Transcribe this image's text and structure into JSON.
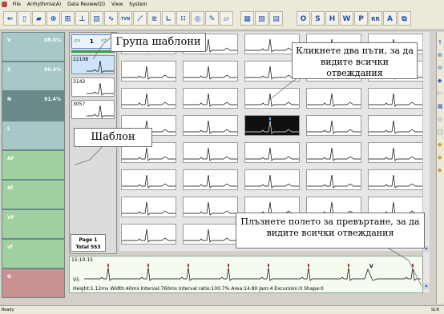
{
  "menu": {
    "items": [
      "File",
      "Arrhythmia(A)",
      "Data Review(D)",
      "View",
      "System"
    ]
  },
  "toolbar": {
    "letters": [
      "O",
      "S",
      "H",
      "W",
      "P",
      "RR",
      "A"
    ],
    "tvn_label": "TVN"
  },
  "categories": [
    {
      "name": "V",
      "pct": "08.0%"
    },
    {
      "name": "S",
      "pct": "00.4%"
    },
    {
      "name": "N",
      "pct": "91.4%"
    },
    {
      "name": "L",
      "pct": ""
    },
    {
      "name": "AF",
      "pct": ""
    },
    {
      "name": "Af",
      "pct": ""
    },
    {
      "name": "VF",
      "pct": ""
    },
    {
      "name": "vf",
      "pct": ""
    },
    {
      "name": "O",
      "pct": ""
    }
  ],
  "templates": {
    "page_indicator": "1",
    "items": [
      {
        "count": "22108"
      },
      {
        "count": "3142"
      },
      {
        "count": "3057"
      }
    ]
  },
  "pagination": {
    "page": "Page 1",
    "total": "Total 553"
  },
  "strip": {
    "time": "15:10:15",
    "lead": "V5",
    "beat_label": "V",
    "measurements": "Height:1.12mv  Width:40ms  Interval:760ms  Interval ratio:100.7%  Area:14.80  Jam:4  Excursion:0  Shape:0"
  },
  "status": {
    "text": "Ready",
    "right": "SCR"
  },
  "callouts": {
    "group": "Група шаблони",
    "dblclick": "Кликнете два пъти, за да видите всички отвеждания",
    "template": "Шаблон",
    "drag": "Плъзнете полето за превъртане, за да видите всички отвеждания"
  },
  "colors": {
    "active_category": "#6a8a8a",
    "category": "#a8c8c8",
    "selected_category": "#a0d0a0",
    "last_category": "#c89090",
    "beat_marker": "#d03030"
  }
}
